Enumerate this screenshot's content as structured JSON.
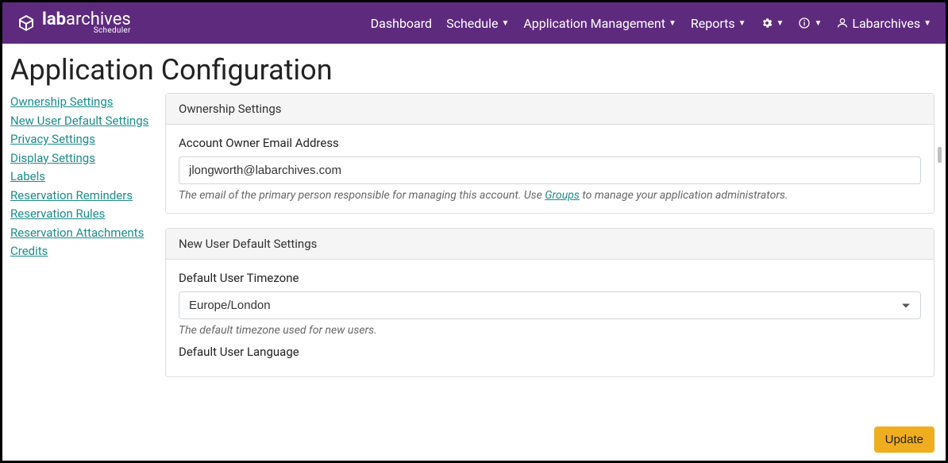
{
  "brand": {
    "bold": "lab",
    "rest": "archives",
    "sub": "Scheduler"
  },
  "nav": {
    "dashboard": "Dashboard",
    "schedule": "Schedule",
    "appmgmt": "Application Management",
    "reports": "Reports",
    "user": "Labarchives"
  },
  "page_title": "Application Configuration",
  "sidebar": {
    "items": [
      "Ownership Settings",
      "New User Default Settings",
      "Privacy Settings",
      "Display Settings",
      "Labels",
      "Reservation Reminders",
      "Reservation Rules",
      "Reservation Attachments",
      "Credits"
    ]
  },
  "sections": {
    "ownership": {
      "header": "Ownership Settings",
      "email_label": "Account Owner Email Address",
      "email_value": "jlongworth@labarchives.com",
      "help_pre": "The email of the primary person responsible for managing this account. Use ",
      "help_link": "Groups",
      "help_post": " to manage your application administrators."
    },
    "newuser": {
      "header": "New User Default Settings",
      "tz_label": "Default User Timezone",
      "tz_value": "Europe/London",
      "tz_help": "The default timezone used for new users.",
      "lang_label": "Default User Language"
    }
  },
  "update_button": "Update"
}
